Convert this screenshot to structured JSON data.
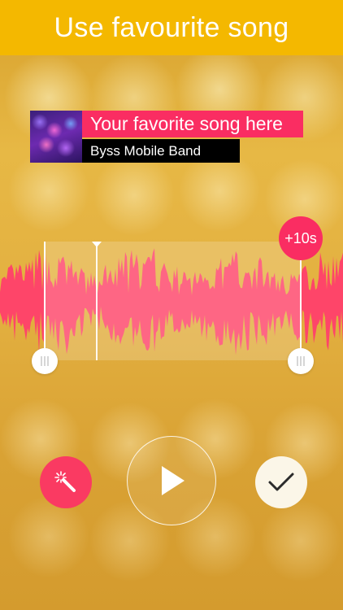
{
  "header": {
    "title": "Use favourite song"
  },
  "song": {
    "title": "Your favorite song here",
    "artist": "Byss Mobile Band"
  },
  "trim": {
    "extend_label": "+10s"
  },
  "controls": {
    "magic": "magic-wand-icon",
    "play": "play-icon",
    "confirm": "checkmark-icon"
  },
  "colors": {
    "header": "#f4b800",
    "accent": "#fa2d62",
    "waveform": "#ff3f6c",
    "confirm_bg": "#fbf6e8"
  }
}
